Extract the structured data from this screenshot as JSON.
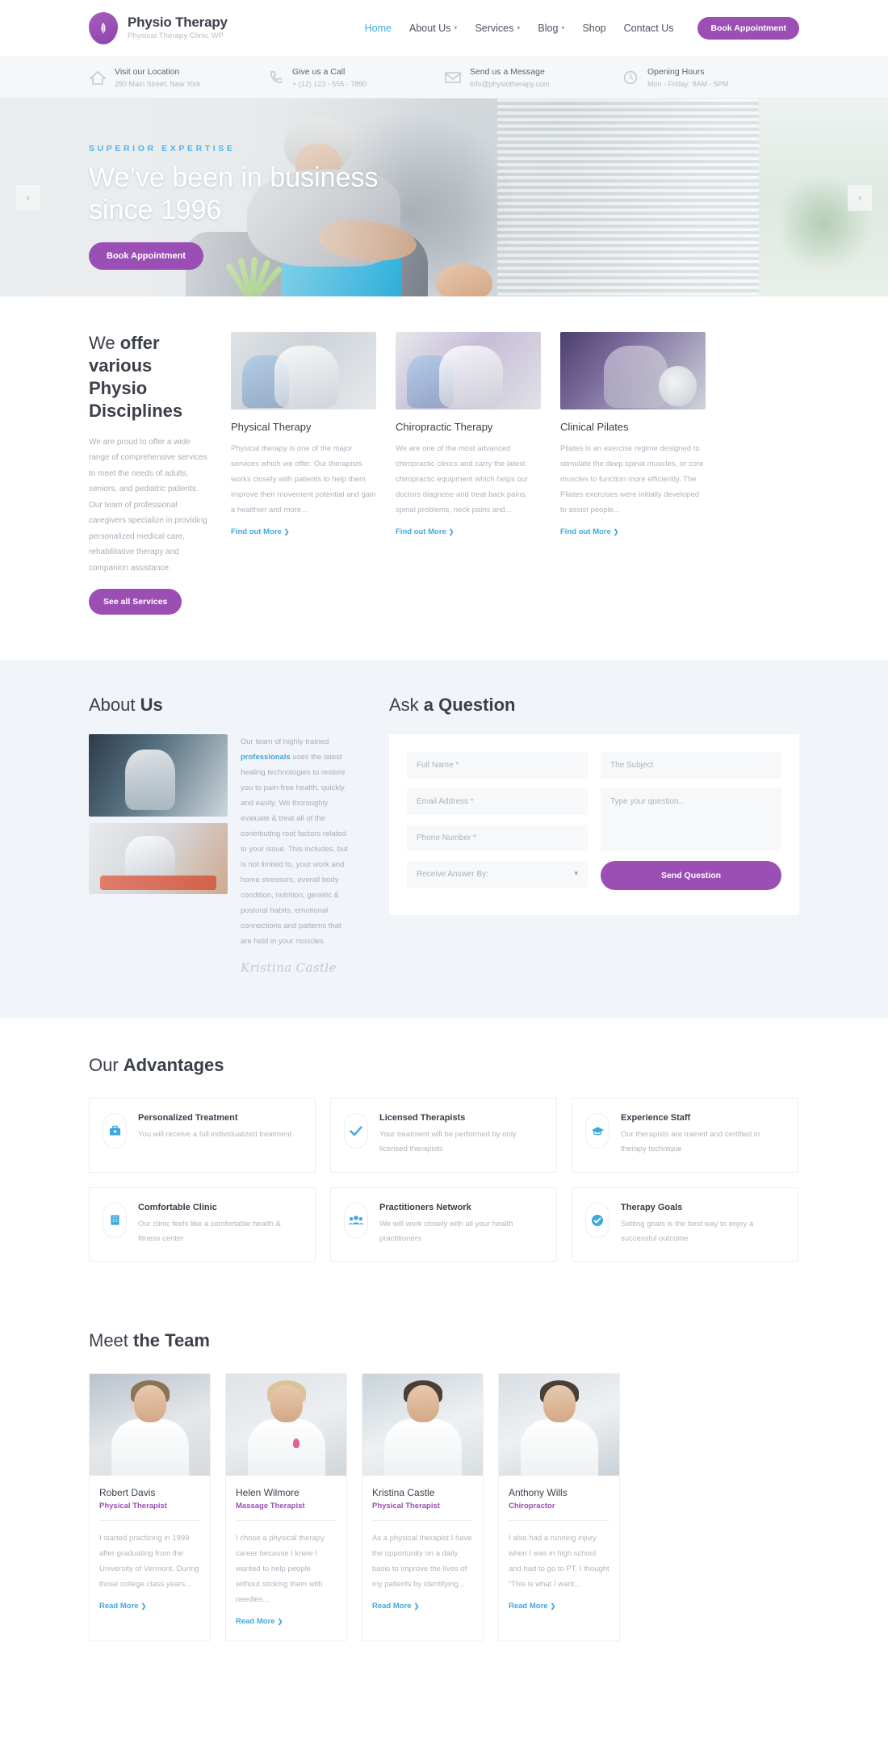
{
  "brand": {
    "title": "Physio Therapy",
    "subtitle": "Physical Therapy Clinic WP",
    "logo_icon": "leaf-icon",
    "accent_purple": "#9b4fb5",
    "accent_blue": "#3ea8dd"
  },
  "nav": {
    "items": [
      {
        "label": "Home",
        "has_caret": false,
        "active": true
      },
      {
        "label": "About Us",
        "has_caret": true,
        "active": false
      },
      {
        "label": "Services",
        "has_caret": true,
        "active": false
      },
      {
        "label": "Blog",
        "has_caret": true,
        "active": false
      },
      {
        "label": "Shop",
        "has_caret": false,
        "active": false
      },
      {
        "label": "Contact Us",
        "has_caret": false,
        "active": false
      }
    ],
    "cta_label": "Book Appointment"
  },
  "infobar": {
    "items": [
      {
        "icon": "home-icon",
        "title": "Visit our Location",
        "sub": "250 Main Street, New York"
      },
      {
        "icon": "phone-icon",
        "title": "Give us a Call",
        "sub": "+ (12) 123 - 556 - 7890"
      },
      {
        "icon": "envelope-icon",
        "title": "Send us a Message",
        "sub": "info@physiotherapy.com"
      },
      {
        "icon": "clock-icon",
        "title": "Opening Hours",
        "sub": "Mon - Friday: 8AM - 5PM"
      }
    ]
  },
  "hero": {
    "eyebrow": "SUPERIOR EXPERTISE",
    "title": "We’ve been in business since 1996",
    "button": "Book Appointment",
    "prev_icon": "chevron-left-icon",
    "next_icon": "chevron-right-icon"
  },
  "services": {
    "heading_light": "We ",
    "heading_bold": "offer various Physio Disciplines",
    "intro": "We are proud to offer a wide range of comprehensive services to meet the needs of adults, seniors, and pediatric patients. Our team of professional caregivers specialize in providing personalized medical care, rehabilitative therapy and companion assistance.",
    "button": "See all Services",
    "link_label": "Find out More",
    "cards": [
      {
        "title": "Physical Therapy",
        "text": "Physical therapy is one of the major services which we offer. Our therapists works closely with patients to help them improve their movement potential and gain a healthier and more..."
      },
      {
        "title": "Chiropractic Therapy",
        "text": "We are one of the most advanced chiropractic clinics and carry the latest chiropractic equipment which helps our doctors diagnose and treat back pains, spinal problems, neck pains and..."
      },
      {
        "title": "Clinical Pilates",
        "text": "Pilates is an exercise regime designed to stimulate the deep spinal muscles, or core muscles to function more efficiently. The Pilates exercises were initially developed to assist people..."
      }
    ]
  },
  "about": {
    "heading_light": "About ",
    "heading_bold": "Us",
    "text_before": "Our team of highly trained ",
    "text_link": "professionals",
    "text_after": " uses the latest healing technologies to restore you to pain-free health, quickly and easily. We thoroughly evaluate & treat all of the contributing root factors related to your issue. This includes, but is not limited to, your work and home stressors, overall body condition, nutrition, genetic & postural habits, emotional connections and patterns that are held in your muscles",
    "signature": "Kristina Castle"
  },
  "ask": {
    "heading_light": "Ask ",
    "heading_bold": "a Question",
    "fields": {
      "full_name": {
        "placeholder": "Full Name *",
        "value": ""
      },
      "email": {
        "placeholder": "Email Address *",
        "value": ""
      },
      "phone": {
        "placeholder": "Phone Number *",
        "value": ""
      },
      "subject": {
        "placeholder": "The Subject",
        "value": ""
      },
      "question": {
        "placeholder": "Type your question..",
        "value": ""
      },
      "receive_by": {
        "label": "Receive Answer By:",
        "selected": "Receive Answer By:"
      }
    },
    "submit_label": "Send Question"
  },
  "advantages": {
    "heading_light": "Our ",
    "heading_bold": "Advantages",
    "cards": [
      {
        "icon": "medical-kit-icon",
        "title": "Personalized Treatment",
        "text": "You will receive a full individualized treatment"
      },
      {
        "icon": "check-icon",
        "title": "Licensed Therapists",
        "text": "Your treatment will be performed by only licensed therapists"
      },
      {
        "icon": "graduation-cap-icon",
        "title": "Experience Staff",
        "text": "Our therapists are trained and certified in therapy technique"
      },
      {
        "icon": "building-icon",
        "title": "Comfortable Clinic",
        "text": "Our clinic feels like a comfortable health & fitness center"
      },
      {
        "icon": "people-icon",
        "title": "Practitioners Network",
        "text": "We will work closely with all your health practitioners"
      },
      {
        "icon": "check-circle-icon",
        "title": "Therapy Goals",
        "text": "Setting goals is the best way to enjoy a successful outcome"
      }
    ]
  },
  "team": {
    "heading_light": "Meet ",
    "heading_bold": "the Team",
    "read_more_label": "Read More",
    "members": [
      {
        "name": "Robert Davis",
        "role": "Physical Therapist",
        "bio": "I started practicing in 1999 after graduating from the University of Vermont. During those college class years..."
      },
      {
        "name": "Helen Wilmore",
        "role": "Massage Therapist",
        "bio": "I chose a physical therapy career because I knew I wanted to help people without sticking them with needles..."
      },
      {
        "name": "Kristina Castle",
        "role": "Physical Therapist",
        "bio": "As a physical therapist I have the opportunity on a daily basis to improve the lives of my patients by identifying..."
      },
      {
        "name": "Anthony Wills",
        "role": "Chiropractor",
        "bio": "I also had a running injury when I was in high school and had to go to PT. I thought “This is what I want..."
      }
    ]
  }
}
